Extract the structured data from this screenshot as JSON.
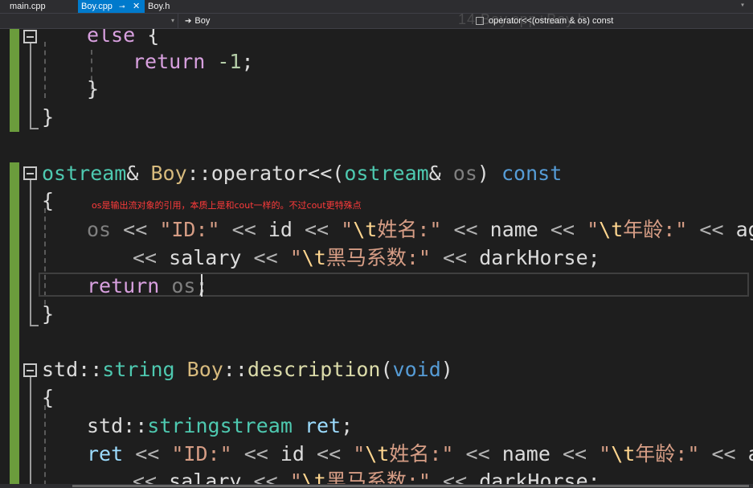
{
  "tabs": [
    {
      "label": "main.cpp"
    },
    {
      "label": "Boy.cpp",
      "pin": "⊸",
      "close": "✕"
    },
    {
      "label": "Boy.h"
    }
  ],
  "tab_overflow": "▾",
  "nav": {
    "project_caret": "▾",
    "scope_arrow": "➔",
    "scope": "Boy",
    "ghost": "14 Boy.cpp+Boy.h",
    "member": "operator<<(ostream & os) const"
  },
  "annotation": "os是输出流对象的引用，本质上是和cout一样的。不过cout更特殊点",
  "code": {
    "l1": {
      "kw": "else",
      "brace": " {"
    },
    "l2": {
      "kw": "return",
      "sp": " ",
      "num": "-1",
      "semi": ";"
    },
    "l3": "}",
    "l4": "}",
    "l5": {
      "t1": "ostream",
      "amp": "& ",
      "cls": "Boy",
      "scope": "::",
      "op": "operator<<",
      "lp": "(",
      "t2": "ostream",
      "amp2": "& ",
      "param": "os",
      "rp": ") ",
      "kw": "const"
    },
    "l6": "{",
    "l7": {
      "os": "os",
      "o1": " << ",
      "s1": "\"ID:\"",
      "o2": " << ",
      "id": "id",
      "o3": " << ",
      "s2a": "\"",
      "e1": "\\t",
      "s2b": "姓名:\"",
      "o4": " << ",
      "name": "name",
      "o5": " << ",
      "s3a": "\"",
      "e2": "\\t",
      "s3b": "年龄:\"",
      "o6": " << ",
      "age": "age"
    },
    "l8": {
      "o1": "<< ",
      "salary": "salary",
      "o2": " << ",
      "s1a": "\"",
      "e1": "\\t",
      "s1b": "黑马系数:\"",
      "o3": " << ",
      "dh": "darkHorse",
      "semi": ";"
    },
    "l9": {
      "kw": "return",
      "sp": " ",
      "os": "os",
      "semi": ";"
    },
    "l10": "}",
    "l11": {
      "ns": "std",
      "sc": "::",
      "ty": "string",
      "sp": " ",
      "cls": "Boy",
      "sc2": "::",
      "fn": "description",
      "lp": "(",
      "kw": "void",
      "rp": ")"
    },
    "l12": "{",
    "l13": {
      "ns": "std",
      "sc": "::",
      "ty": "stringstream",
      "sp": " ",
      "var": "ret",
      "semi": ";"
    },
    "l14": {
      "ret": "ret",
      "o1": " << ",
      "s1": "\"ID:\"",
      "o2": " << ",
      "id": "id",
      "o3": " << ",
      "s2a": "\"",
      "e1": "\\t",
      "s2b": "姓名:\"",
      "o4": " << ",
      "name": "name",
      "o5": " << ",
      "s3a": "\"",
      "e2": "\\t",
      "s3b": "年龄:\"",
      "o6": " << ",
      "age": "age"
    },
    "l15": {
      "o1": "<< ",
      "salary": "salary",
      "o2": " << ",
      "s1a": "\"",
      "e1": "\\t",
      "s1b": "黑马系数:\"",
      "o3": " << ",
      "dh": "darkHorse",
      "semi": ";"
    }
  },
  "colors": {
    "keyword": "#569cd6",
    "control": "#d8a0df",
    "type": "#4ec9b0",
    "function": "#dcdcaa",
    "string": "#d69d85",
    "escape": "#ffd68f",
    "number": "#b5cea8",
    "variable": "#9cdcfe",
    "annotation": "#ff3b3b",
    "active_tab": "#007acc",
    "change_bar": "#6b9c3c"
  }
}
